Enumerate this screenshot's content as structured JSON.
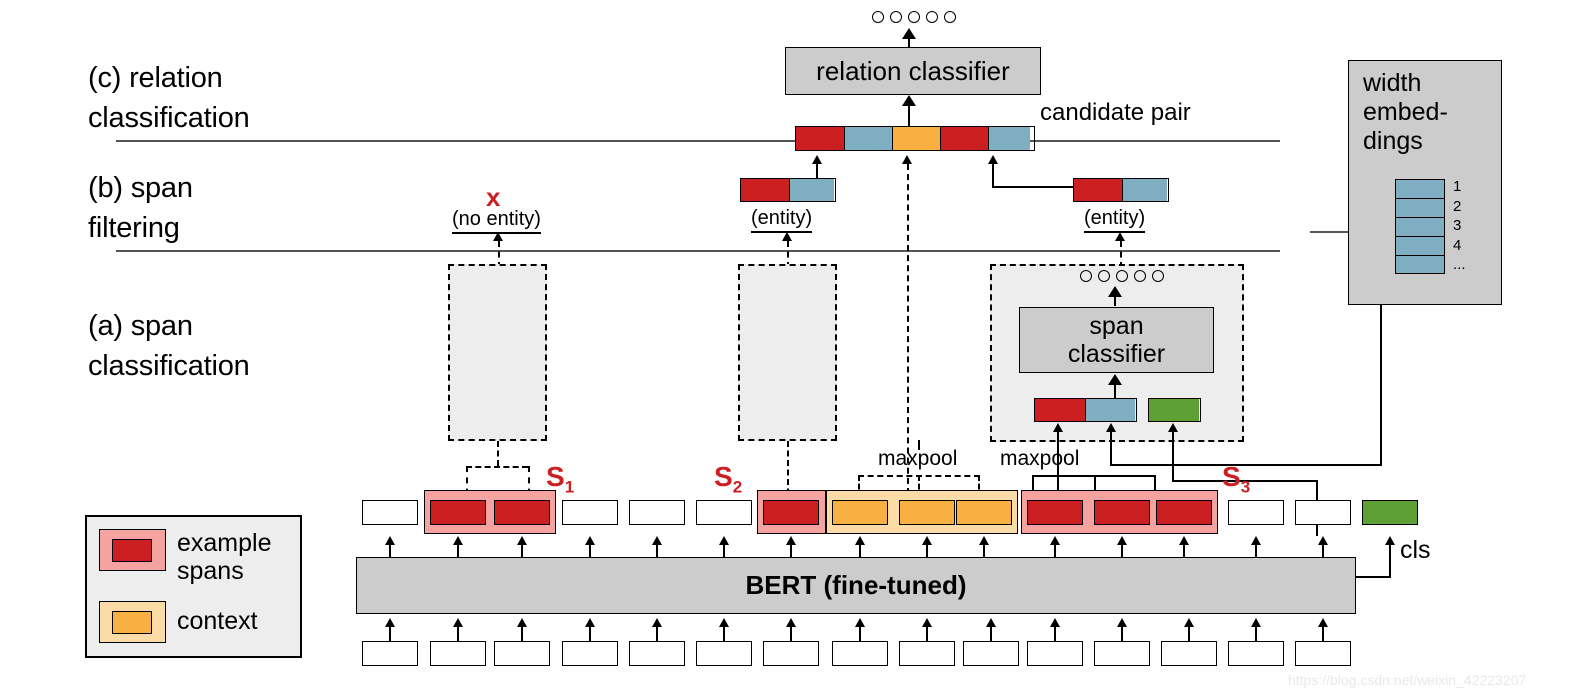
{
  "figure": {
    "watermark": "https://blog.csdn.net/weixin_42223207"
  },
  "sections": [
    {
      "id": "c",
      "label": "(c) relation\n    classification"
    },
    {
      "id": "b",
      "label": "(b) span\n     filtering"
    },
    {
      "id": "a",
      "label": "(a) span\n    classification"
    }
  ],
  "relation_level": {
    "classifier_label": "relation classifier",
    "candidate_pair_label": "candidate pair",
    "output_circles": 5,
    "candidate_pair_segments": [
      "red",
      "blue",
      "orange",
      "red",
      "blue"
    ]
  },
  "filtering_level": {
    "no_entity_marker": "x",
    "no_entity_label": "(no entity)",
    "entity_label_left": "(entity)",
    "entity_label_right": "(entity)",
    "entity_bar_segments": [
      "red",
      "blue"
    ]
  },
  "span_level": {
    "classifier_label": "span\nclassifier",
    "output_circles": 5,
    "input_segments": [
      "red",
      "blue",
      "green"
    ],
    "maxpool_label_context": "maxpool",
    "maxpool_label_span": "maxpool"
  },
  "width_embeddings": {
    "title": "width\nembed-\ndings",
    "cell_count": 5,
    "numbers": [
      "1",
      "2",
      "3",
      "4",
      "..."
    ]
  },
  "legend": {
    "items": [
      {
        "swatch": "pink",
        "inner": "red",
        "label": "example\nspans"
      },
      {
        "swatch": "peach",
        "inner": "orange",
        "label": "context"
      }
    ]
  },
  "encoder": {
    "label": "BERT (fine-tuned)",
    "cls_label": "cls",
    "input_token_count": 15
  },
  "token_row": {
    "count": 15,
    "tokens": [
      {
        "index": 0,
        "type": "plain"
      },
      {
        "index": 1,
        "type": "red",
        "group": "S1"
      },
      {
        "index": 2,
        "type": "red",
        "group": "S1"
      },
      {
        "index": 3,
        "type": "plain"
      },
      {
        "index": 4,
        "type": "plain"
      },
      {
        "index": 5,
        "type": "plain"
      },
      {
        "index": 6,
        "type": "red",
        "group": "S2"
      },
      {
        "index": 7,
        "type": "orange",
        "group": "context"
      },
      {
        "index": 8,
        "type": "orange",
        "group": "context"
      },
      {
        "index": 9,
        "type": "orange",
        "group": "context"
      },
      {
        "index": 10,
        "type": "red",
        "group": "S3"
      },
      {
        "index": 11,
        "type": "red",
        "group": "S3"
      },
      {
        "index": 12,
        "type": "red",
        "group": "S3"
      },
      {
        "index": 13,
        "type": "plain"
      },
      {
        "index": 14,
        "type": "plain"
      }
    ],
    "span_labels": [
      {
        "name": "S",
        "sub": "1"
      },
      {
        "name": "S",
        "sub": "2"
      },
      {
        "name": "S",
        "sub": "3"
      }
    ]
  },
  "colors": {
    "red": "#cc1f22",
    "blue": "#7fadc2",
    "orange": "#f9b042",
    "green": "#5ea033",
    "pink": "#f5a3a0",
    "peach": "#fcdca6",
    "grey_box": "#cccccc",
    "panel": "#ededed"
  }
}
